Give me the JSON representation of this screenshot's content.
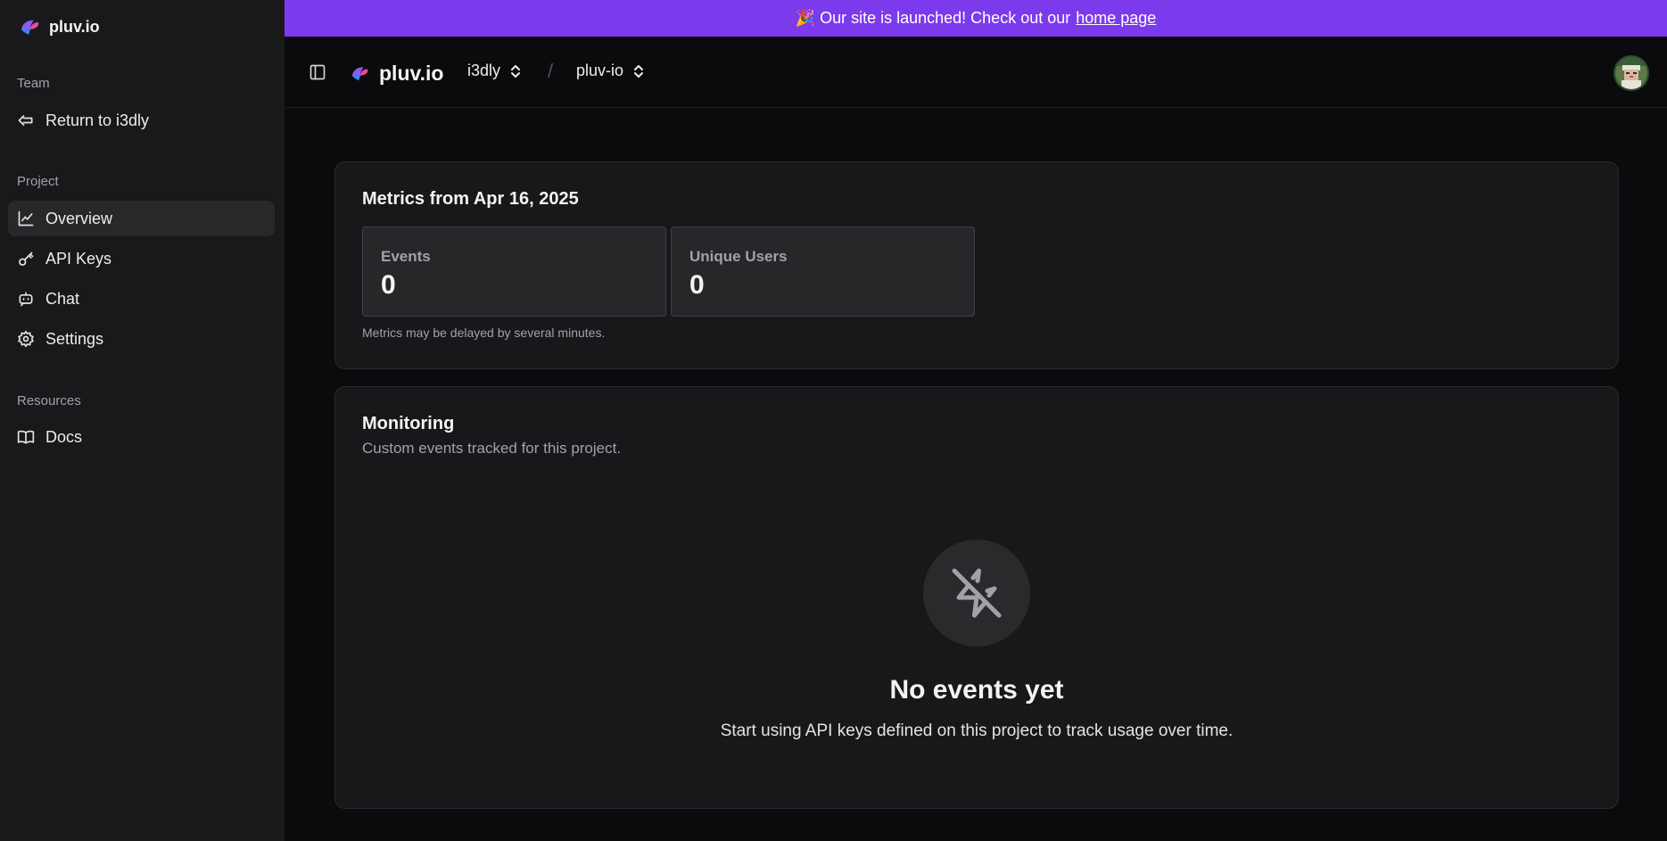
{
  "app": {
    "name": "pluv.io"
  },
  "banner": {
    "text": "🎉 Our site is launched! Check out our",
    "link": "home page",
    "color": "#7c3aed"
  },
  "sidebar": {
    "brand": "pluv.io",
    "sections": [
      {
        "label": "Team",
        "items": [
          {
            "label": "Return to i3dly",
            "icon": "return-arrow-icon"
          }
        ]
      },
      {
        "label": "Project",
        "items": [
          {
            "label": "Overview",
            "icon": "chart-line-icon",
            "active": true
          },
          {
            "label": "API Keys",
            "icon": "key-icon"
          },
          {
            "label": "Chat",
            "icon": "bot-chat-icon"
          },
          {
            "label": "Settings",
            "icon": "gear-icon"
          }
        ]
      },
      {
        "label": "Resources",
        "items": [
          {
            "label": "Docs",
            "icon": "book-icon"
          }
        ]
      }
    ]
  },
  "header": {
    "logo": "pluv.io",
    "team": "i3dly",
    "separator": "/",
    "project": "pluv-io"
  },
  "metrics": {
    "title": "Metrics from Apr 16, 2025",
    "cards": [
      {
        "label": "Events",
        "value": "0"
      },
      {
        "label": "Unique Users",
        "value": "0"
      }
    ],
    "note": "Metrics may be delayed by several minutes."
  },
  "monitoring": {
    "title": "Monitoring",
    "subtitle": "Custom events tracked for this project.",
    "empty": {
      "icon": "zap-off-icon",
      "title": "No events yet",
      "description": "Start using API keys defined on this project to track usage over time."
    }
  }
}
